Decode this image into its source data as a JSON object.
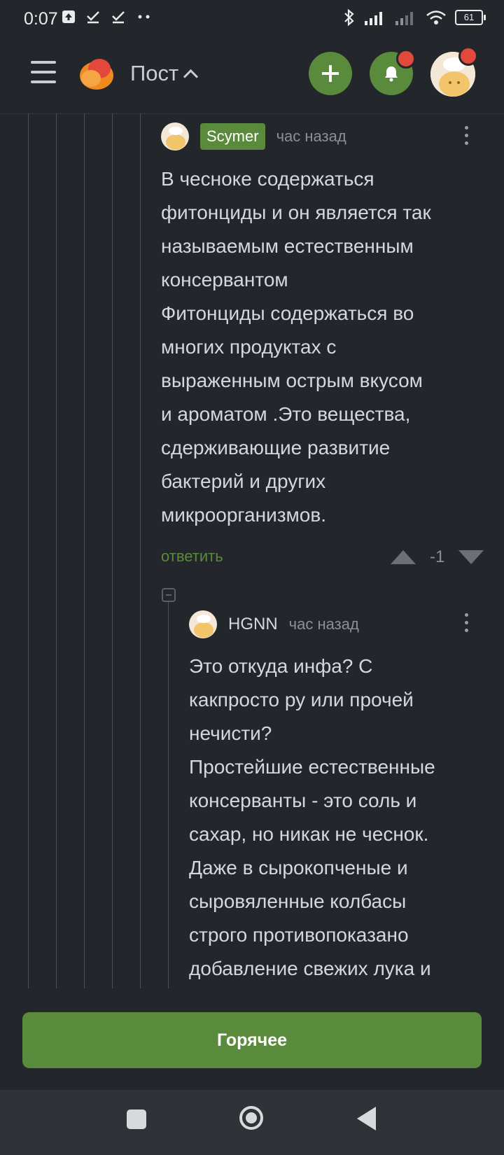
{
  "status_bar": {
    "time": "0:07",
    "battery": "61"
  },
  "header": {
    "title": "Пост",
    "icons": [
      "menu-icon",
      "logo-icon",
      "plus-icon",
      "bell-icon",
      "avatar"
    ]
  },
  "comments": [
    {
      "author": "Scymer",
      "time": "час назад",
      "text": "В чесноке содержаться\nфитонциды и он является так\nназываемым естественным\nконсервантом\nФитонциды содержаться во\nмногих продуктах с\nвыраженным острым вкусом\nи ароматом .Это вещества,\nсдерживающие развитие\nбактерий и других\nмикроорганизмов.",
      "reply_label": "ответить",
      "rating": "-1"
    },
    {
      "author": "HGNN",
      "time": "час назад",
      "text": "Это откуда инфа? С\nкакпросто ру или прочей\nнечисти?\nПростейшие естественные\nконсерванты - это соль и\nсахар, но никак не чеснок.\nДаже в сырокопченые и\nсыровяленные колбасы\nстрого противопоказано\nдобавление свежих лука и"
    }
  ],
  "bottom": {
    "hot_label": "Горячее"
  },
  "colors": {
    "background": "#23272b",
    "accent_green": "#5a8a3b",
    "notification_red": "#e2483c"
  }
}
